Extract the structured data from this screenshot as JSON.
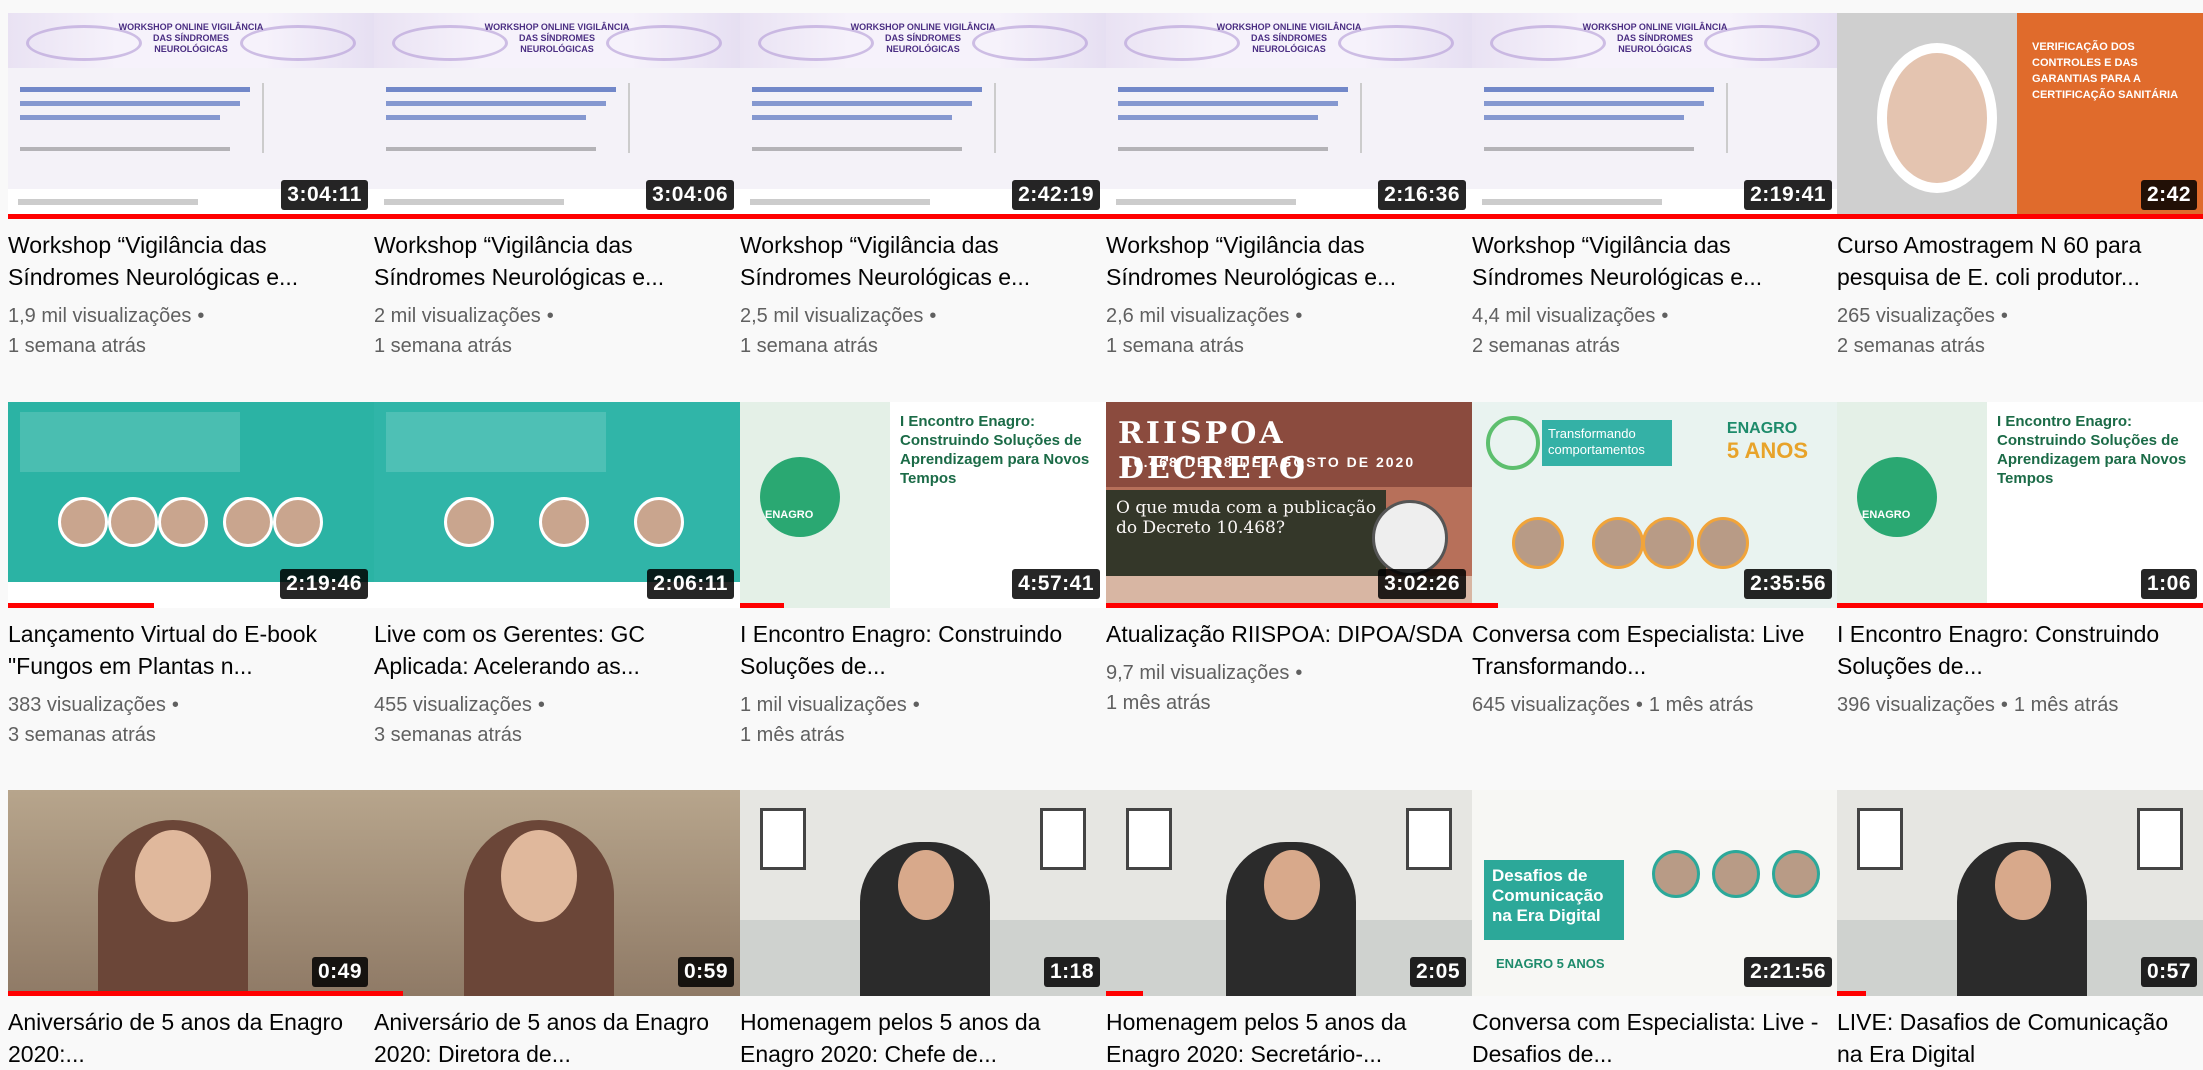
{
  "videos": [
    {
      "title": "Workshop “Vigilância das Síndromes Neurológicas e...",
      "views": "1,9 mil visualizações",
      "age": "1 semana atrás",
      "duration": "3:04:11",
      "watched": 1.0,
      "thumb_style": "workshop",
      "meta_inline": false
    },
    {
      "title": "Workshop “Vigilância das Síndromes Neurológicas e...",
      "views": "2 mil visualizações",
      "age": "1 semana atrás",
      "duration": "3:04:06",
      "watched": 1.0,
      "thumb_style": "workshop",
      "meta_inline": false
    },
    {
      "title": "Workshop “Vigilância das Síndromes Neurológicas e...",
      "views": "2,5 mil visualizações",
      "age": "1 semana atrás",
      "duration": "2:42:19",
      "watched": 1.0,
      "thumb_style": "workshop",
      "meta_inline": false
    },
    {
      "title": "Workshop “Vigilância das Síndromes Neurológicas e...",
      "views": "2,6 mil visualizações",
      "age": "1 semana atrás",
      "duration": "2:16:36",
      "watched": 1.0,
      "thumb_style": "workshop",
      "meta_inline": false
    },
    {
      "title": "Workshop “Vigilância das Síndromes Neurológicas e...",
      "views": "4,4 mil visualizações",
      "age": "2 semanas atrás",
      "duration": "2:19:41",
      "watched": 1.0,
      "thumb_style": "workshop",
      "meta_inline": false
    },
    {
      "title": "Curso Amostragem N 60 para pesquisa de E. coli produtor...",
      "views": "265 visualizações",
      "age": "2 semanas atrás",
      "duration": "2:42",
      "watched": 1.0,
      "thumb_style": "cover",
      "meta_inline": false
    },
    {
      "title": "Lançamento Virtual do E-book \"Fungos em Plantas n...",
      "views": "383 visualizações",
      "age": "3 semanas atrás",
      "duration": "2:19:46",
      "watched": 0.4,
      "thumb_style": "green",
      "meta_inline": false
    },
    {
      "title": "Live com os Gerentes: GC Aplicada: Acelerando as...",
      "views": "455 visualizações",
      "age": "3 semanas atrás",
      "duration": "2:06:11",
      "watched": 0.0,
      "thumb_style": "green2",
      "meta_inline": false
    },
    {
      "title": "I Encontro Enagro: Construindo Soluções de...",
      "views": "1 mil visualizações",
      "age": "1 mês atrás",
      "duration": "4:57:41",
      "watched": 0.12,
      "thumb_style": "enagro",
      "meta_inline": false
    },
    {
      "title": "Atualização RIISPOA: DIPOA/SDA",
      "views": "9,7 mil visualizações",
      "age": "1 mês atrás",
      "duration": "3:02:26",
      "watched": 1.0,
      "thumb_style": "riispoa",
      "meta_inline": false
    },
    {
      "title": "Conversa com Especialista: Live Transformando...",
      "views": "645 visualizações",
      "age": "1 mês atrás",
      "duration": "2:35:56",
      "watched": 0.07,
      "thumb_style": "live",
      "meta_inline": true
    },
    {
      "title": "I Encontro Enagro: Construindo Soluções de...",
      "views": "396 visualizações",
      "age": "1 mês atrás",
      "duration": "1:06",
      "watched": 1.0,
      "thumb_style": "enagro",
      "meta_inline": true
    },
    {
      "title": "Aniversário de 5 anos da Enagro 2020:...",
      "views": "",
      "age": "",
      "duration": "0:49",
      "watched": 1.0,
      "thumb_style": "photo",
      "meta_inline": false
    },
    {
      "title": "Aniversário de 5 anos da Enagro 2020: Diretora de...",
      "views": "",
      "age": "",
      "duration": "0:59",
      "watched": 0.08,
      "thumb_style": "photo",
      "meta_inline": false
    },
    {
      "title": "Homenagem pelos 5 anos da Enagro 2020: Chefe de...",
      "views": "",
      "age": "",
      "duration": "1:18",
      "watched": 0.0,
      "thumb_style": "office",
      "meta_inline": false
    },
    {
      "title": "Homenagem pelos 5 anos da Enagro 2020: Secretário-...",
      "views": "",
      "age": "",
      "duration": "2:05",
      "watched": 0.1,
      "thumb_style": "office",
      "meta_inline": false
    },
    {
      "title": "Conversa com Especialista: Live - Desafios de...",
      "views": "",
      "age": "",
      "duration": "2:21:56",
      "watched": 0.0,
      "thumb_style": "desafios",
      "meta_inline": false
    },
    {
      "title": "LIVE: Dasafios de Comunicação na Era Digital",
      "views": "",
      "age": "",
      "duration": "0:57",
      "watched": 0.08,
      "thumb_style": "office",
      "meta_inline": false
    }
  ],
  "thumb_text": {
    "workshop_header": "WORKSHOP ONLINE VIGILÂNCIA DAS SÍNDROMES NEUROLÓGICAS",
    "cover": "VERIFICAÇÃO DOS CONTROLES E DAS GARANTIAS PARA A CERTIFICAÇÃO SANITÁRIA",
    "enagro_title": "I Encontro Enagro: Construindo Soluções de Aprendizagem para Novos Tempos",
    "riispoa_title": "RIISPOA DECRETO",
    "riispoa_sub": "10.468 DE 18 DE AGOSTO DE 2020",
    "riispoa_question": "O que muda com a publicação do Decreto 10.468?",
    "live_title": "Transformando comportamentos",
    "live_brand": "ENAGRO",
    "live_years": "5 ANOS",
    "desafios_title": "Desafios de Comunicação na Era Digital",
    "desafios_brand": "ENAGRO 5 ANOS"
  },
  "colors": {
    "progress": "#ff0000",
    "meta": "#606060",
    "title": "#030303",
    "background": "#f9f9f9"
  }
}
